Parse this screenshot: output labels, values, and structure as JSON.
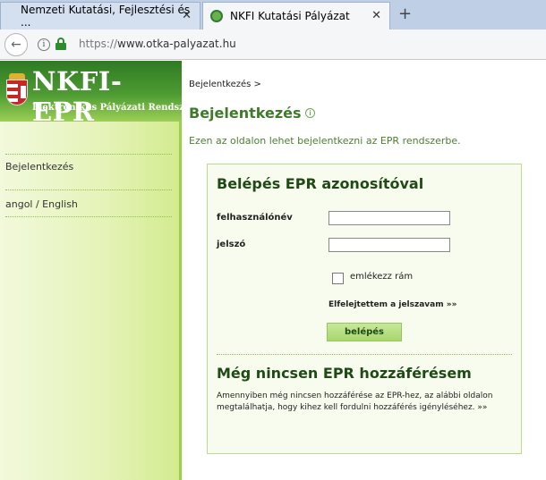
{
  "browser": {
    "tabs": [
      {
        "label": "Nemzeti Kutatási, Fejlesztési és ..."
      },
      {
        "label": "NKFI Kutatási Pályázat"
      }
    ],
    "new_tab": "+",
    "close": "✕",
    "url_protocol": "https://",
    "url_host": "www.otka-palyazat.hu"
  },
  "logo": {
    "title": "NKFI-EPR",
    "subtitle": "Elektronikus Pályázati Rendszer"
  },
  "sidebar": {
    "items": [
      {
        "label": "Bejelentkezés"
      },
      {
        "label": "angol / English"
      }
    ]
  },
  "main": {
    "breadcrumb": "Bejelentkezés >",
    "page_title": "Bejelentkezés",
    "intro": "Ezen az oldalon lehet bejelentkezni az EPR rendszerbe.",
    "login": {
      "title": "Belépés EPR azonosítóval",
      "username_label": "felhasználónév",
      "username_value": "",
      "password_label": "jelszó",
      "password_value": "",
      "remember_label": "emlékezz rám",
      "forgot_label": "Elfelejtettem a jelszavam »»",
      "submit_label": "belépés"
    },
    "no_access": {
      "title": "Még nincsen EPR hozzáférésem",
      "text": "Amennyiben még nincsen hozzáférése az EPR-hez, az alábbi oldalon megtalálhatja, hogy kihez kell fordulni hozzáférés igényléséhez. »»"
    }
  }
}
